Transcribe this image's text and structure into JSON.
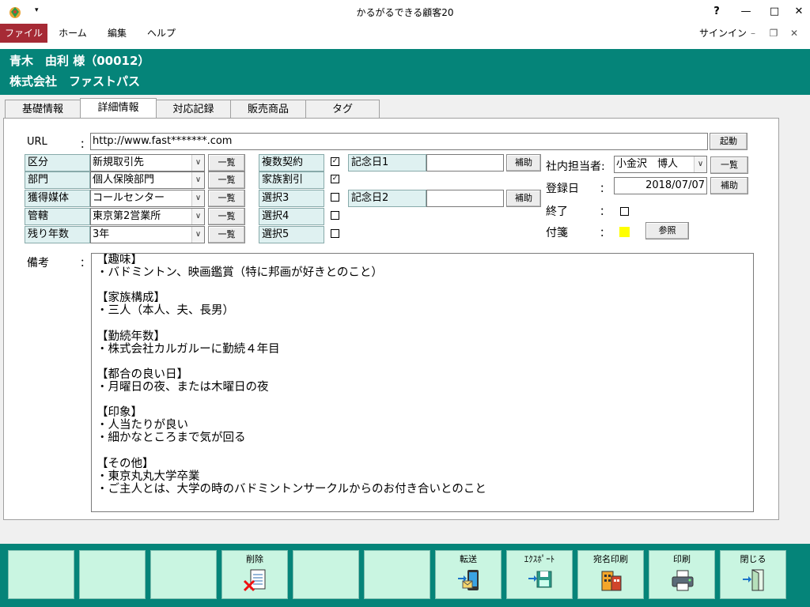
{
  "window": {
    "title": "かるがるできる顧客20",
    "controls": {
      "help": "?",
      "minimize": "—",
      "maximize": "□",
      "close": "✕"
    }
  },
  "menu": {
    "items": [
      "ファイル",
      "ホーム",
      "編集",
      "ヘルプ"
    ],
    "signin": "サインイン",
    "sub_min": "–",
    "sub_restore": "❐",
    "sub_close": "✕"
  },
  "customer": {
    "name_line": "青木　由利 様（00012）",
    "company_line": "株式会社　ファストパス"
  },
  "tabs": [
    "基礎情報",
    "詳細情報",
    "対応記録",
    "販売商品",
    "タグ"
  ],
  "active_tab": "詳細情報",
  "url": {
    "label": "URL",
    "colon": "：",
    "value": "http://www.fast*******.com",
    "launch_button": "起動"
  },
  "fields": [
    {
      "label": "区分",
      "value": "新規取引先",
      "button": "一覧"
    },
    {
      "label": "部門",
      "value": "個人保険部門",
      "button": "一覧"
    },
    {
      "label": "獲得媒体",
      "value": "コールセンター",
      "button": "一覧"
    },
    {
      "label": "管轄",
      "value": "東京第2営業所",
      "button": "一覧"
    },
    {
      "label": "残り年数",
      "value": "3年",
      "button": "一覧"
    }
  ],
  "options": [
    {
      "label": "複数契約",
      "checked": true,
      "mark": "✓"
    },
    {
      "label": "家族割引",
      "checked": true,
      "mark": "✓"
    },
    {
      "label": "選択3",
      "checked": false,
      "mark": ""
    },
    {
      "label": "選択4",
      "checked": false,
      "mark": ""
    },
    {
      "label": "選択5",
      "checked": false,
      "mark": ""
    }
  ],
  "anniversaries": [
    {
      "label": "記念日1",
      "value": "",
      "button": "補助"
    },
    {
      "label": "記念日2",
      "value": "",
      "button": "補助"
    }
  ],
  "staff": {
    "label": "社内担当者:",
    "value": "小金沢　博人",
    "button": "一覧"
  },
  "registered": {
    "label": "登録日",
    "colon": "：",
    "value": "2018/07/07",
    "button": "補助"
  },
  "finished": {
    "label": "終了",
    "colon": "：",
    "checked": false
  },
  "sticky": {
    "label": "付箋",
    "colon": "：",
    "color": "#ffff00",
    "button": "参照"
  },
  "remarks": {
    "label": "備考",
    "colon": "：",
    "text": "【趣味】\n・バドミントン、映画鑑賞（特に邦画が好きとのこと）\n\n【家族構成】\n・三人（本人、夫、長男）\n\n【勤続年数】\n・株式会社カルガルーに勤続４年目\n\n【都合の良い日】\n・月曜日の夜、または木曜日の夜\n\n【印象】\n・人当たりが良い\n・細かなところまで気が回る\n\n【その他】\n・東京丸丸大学卒業\n・ご主人とは、大学の時のバドミントンサークルからのお付き合いとのこと"
  },
  "footer_buttons": [
    {
      "label": ""
    },
    {
      "label": ""
    },
    {
      "label": ""
    },
    {
      "label": "削除",
      "icon": "delete-icon"
    },
    {
      "label": ""
    },
    {
      "label": ""
    },
    {
      "label": "転送",
      "icon": "transfer-icon"
    },
    {
      "label": "ｴｸｽﾎﾟｰﾄ",
      "icon": "export-icon"
    },
    {
      "label": "宛名印刷",
      "icon": "address-print-icon"
    },
    {
      "label": "印刷",
      "icon": "printer-icon"
    },
    {
      "label": "閉じる",
      "icon": "exit-icon"
    }
  ],
  "colors": {
    "accent": "#058479",
    "file_menu": "#a62a35",
    "footer_button": "#c9f5e1"
  }
}
